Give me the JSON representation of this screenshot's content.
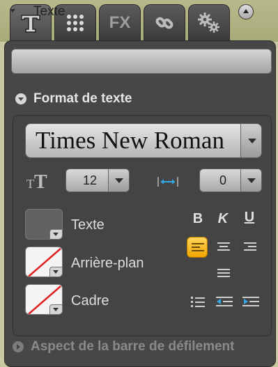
{
  "tabs": [
    {
      "name": "text-tab",
      "icon": "text-tool-icon",
      "active": true
    },
    {
      "name": "grid-tab",
      "icon": "grid-dots-icon",
      "active": false
    },
    {
      "name": "fx-tab",
      "icon": "fx-icon",
      "label": "FX",
      "active": false
    },
    {
      "name": "link-tab",
      "icon": "chain-link-icon",
      "active": false
    },
    {
      "name": "settings-tab",
      "icon": "gears-icon",
      "active": false
    }
  ],
  "header": {
    "title": "Texte"
  },
  "text_format": {
    "section_title": "Format de texte",
    "font_family": "Times New Roman",
    "size_prefix": "TT",
    "font_size": "12",
    "spacing": "0",
    "swatches": [
      {
        "label": "Texte",
        "style": "solid"
      },
      {
        "label": "Arrière-plan",
        "style": "none"
      },
      {
        "label": "Cadre",
        "style": "none"
      }
    ],
    "bold": "B",
    "italic": "K",
    "underline": "U"
  },
  "scrollbar_section": {
    "title": "Aspect de la barre de défilement"
  },
  "colors": {
    "accent": "#f2a600",
    "panel": "#474747",
    "tab": "#4a4a4a"
  }
}
